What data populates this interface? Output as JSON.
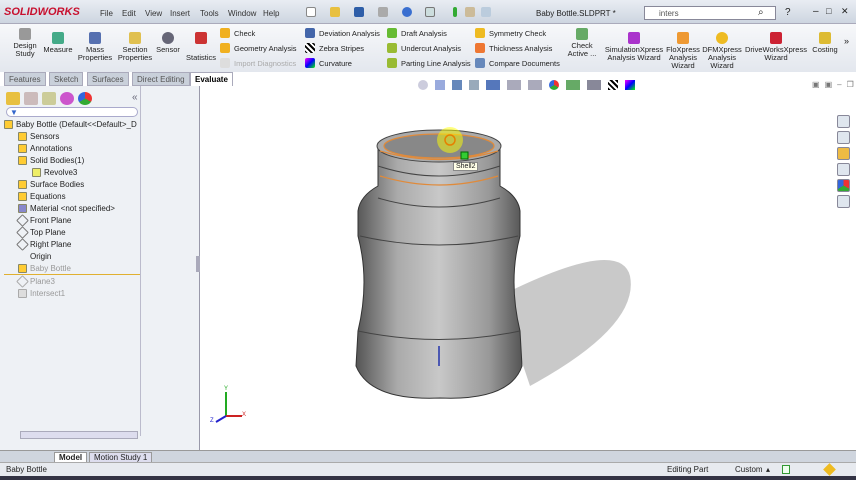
{
  "app": {
    "brand": "SOLIDWORKS",
    "title": "Baby Bottle.SLDPRT *",
    "search_value": "inters"
  },
  "menu": [
    "File",
    "Edit",
    "View",
    "Insert",
    "Tools",
    "Window",
    "Help"
  ],
  "ribbon": {
    "big": [
      "Design Study",
      "Measure",
      "Mass Properties",
      "Section Properties",
      "Sensor",
      "Statistics"
    ],
    "col1": [
      "Check",
      "Geometry Analysis",
      "Import Diagnostics"
    ],
    "col2": [
      "Deviation Analysis",
      "Zebra Stripes",
      "Curvature"
    ],
    "col3": [
      "Draft Analysis",
      "Undercut Analysis",
      "Parting Line Analysis"
    ],
    "col4": [
      "Symmetry Check",
      "Thickness Analysis",
      "Compare Documents"
    ],
    "check_active": "Check Active ...",
    "wizards": [
      "SimulationXpress Analysis Wizard",
      "FloXpress Analysis Wizard",
      "DFMXpress Analysis Wizard",
      "DriveWorksXpress Wizard",
      "Costing"
    ],
    "more": "»"
  },
  "tabs": [
    "Features",
    "Sketch",
    "Surfaces",
    "Direct Editing",
    "Evaluate"
  ],
  "active_tab": "Evaluate",
  "tree": {
    "root": "Baby Bottle  (Default<<Default>_D",
    "items": [
      "Sensors",
      "Annotations",
      "Solid Bodies(1)",
      "Revolve3",
      "Surface Bodies",
      "Equations",
      "Material <not specified>",
      "Front Plane",
      "Top Plane",
      "Right Plane",
      "Origin",
      "Baby Bottle",
      "Plane3",
      "Intersect1"
    ]
  },
  "viewport": {
    "tooltip": "Shell2",
    "axis": {
      "x": "X",
      "y": "Y",
      "z": "Z"
    }
  },
  "bottom_tabs": [
    "Model",
    "Motion Study 1"
  ],
  "status": {
    "left": "Baby Bottle",
    "mode": "Editing Part",
    "units": "Custom"
  },
  "colors": {
    "accent": "#c8102e",
    "edge": "#e08a3a"
  }
}
